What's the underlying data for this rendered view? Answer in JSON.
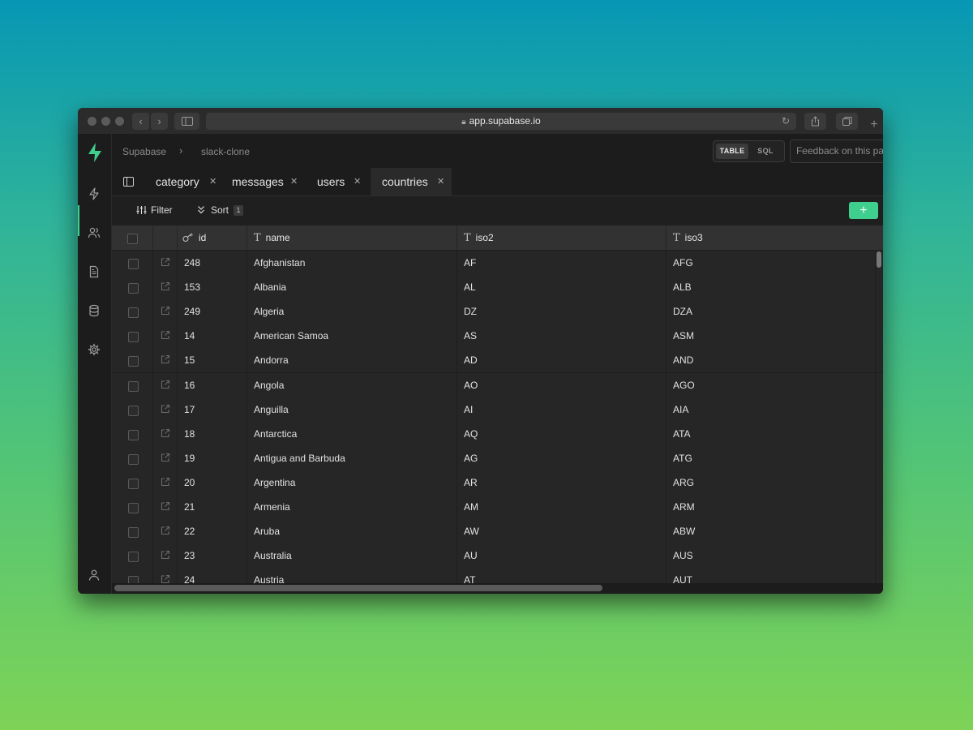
{
  "browser": {
    "url": "app.supabase.io"
  },
  "breadcrumb": {
    "org": "Supabase",
    "separator": "›",
    "project": "slack-clone"
  },
  "view_toggle": {
    "table_label": "TABLE",
    "sql_label": "SQL",
    "active": "TABLE"
  },
  "feedback": {
    "placeholder": "Feedback on this page?"
  },
  "tabs": [
    {
      "label": "category"
    },
    {
      "label": "messages"
    },
    {
      "label": "users"
    },
    {
      "label": "countries",
      "active": true
    }
  ],
  "toolbar": {
    "filter_label": "Filter",
    "sort_label": "Sort",
    "sort_count": "1",
    "add_label": "+"
  },
  "columns": [
    {
      "label": "id",
      "type_icon": "key-icon"
    },
    {
      "label": "name",
      "type_icon": "text-type-icon"
    },
    {
      "label": "iso2",
      "type_icon": "text-type-icon"
    },
    {
      "label": "iso3",
      "type_icon": "text-type-icon"
    }
  ],
  "rows": [
    {
      "id": "248",
      "name": "Afghanistan",
      "iso2": "AF",
      "iso3": "AFG"
    },
    {
      "id": "153",
      "name": "Albania",
      "iso2": "AL",
      "iso3": "ALB"
    },
    {
      "id": "249",
      "name": "Algeria",
      "iso2": "DZ",
      "iso3": "DZA"
    },
    {
      "id": "14",
      "name": "American Samoa",
      "iso2": "AS",
      "iso3": "ASM"
    },
    {
      "id": "15",
      "name": "Andorra",
      "iso2": "AD",
      "iso3": "AND"
    },
    {
      "id": "16",
      "name": "Angola",
      "iso2": "AO",
      "iso3": "AGO"
    },
    {
      "id": "17",
      "name": "Anguilla",
      "iso2": "AI",
      "iso3": "AIA"
    },
    {
      "id": "18",
      "name": "Antarctica",
      "iso2": "AQ",
      "iso3": "ATA"
    },
    {
      "id": "19",
      "name": "Antigua and Barbuda",
      "iso2": "AG",
      "iso3": "ATG"
    },
    {
      "id": "20",
      "name": "Argentina",
      "iso2": "AR",
      "iso3": "ARG"
    },
    {
      "id": "21",
      "name": "Armenia",
      "iso2": "AM",
      "iso3": "ARM"
    },
    {
      "id": "22",
      "name": "Aruba",
      "iso2": "AW",
      "iso3": "ABW"
    },
    {
      "id": "23",
      "name": "Australia",
      "iso2": "AU",
      "iso3": "AUS"
    },
    {
      "id": "24",
      "name": "Austria",
      "iso2": "AT",
      "iso3": "AUT"
    }
  ],
  "sidebar_icons": [
    "supabase-logo-icon",
    "bolt-icon",
    "users-icon",
    "document-icon",
    "database-icon",
    "gear-icon",
    "user-icon"
  ],
  "colors": {
    "accent": "#3ecf8e",
    "background": "#1c1c1c",
    "grid": "#262626"
  }
}
